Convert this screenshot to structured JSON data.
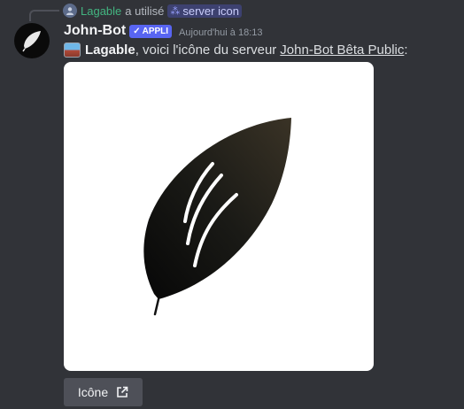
{
  "reply": {
    "user": "Lagable",
    "action": "a utilisé",
    "command": "server icon"
  },
  "message": {
    "author": "John-Bot",
    "badge": "APPLI",
    "timestamp": "Aujourd'hui à 18:13",
    "mention": "Lagable",
    "text_before": ", voici l'icône du serveur",
    "server_name": "John-Bot Bêta Public",
    "text_after": " :"
  },
  "button": {
    "label": "Icône",
    "icon": "external-link-icon"
  },
  "colors": {
    "background": "#313338",
    "brand": "#5865f2",
    "reply_user": "#43b581",
    "button": "#4e5058"
  }
}
